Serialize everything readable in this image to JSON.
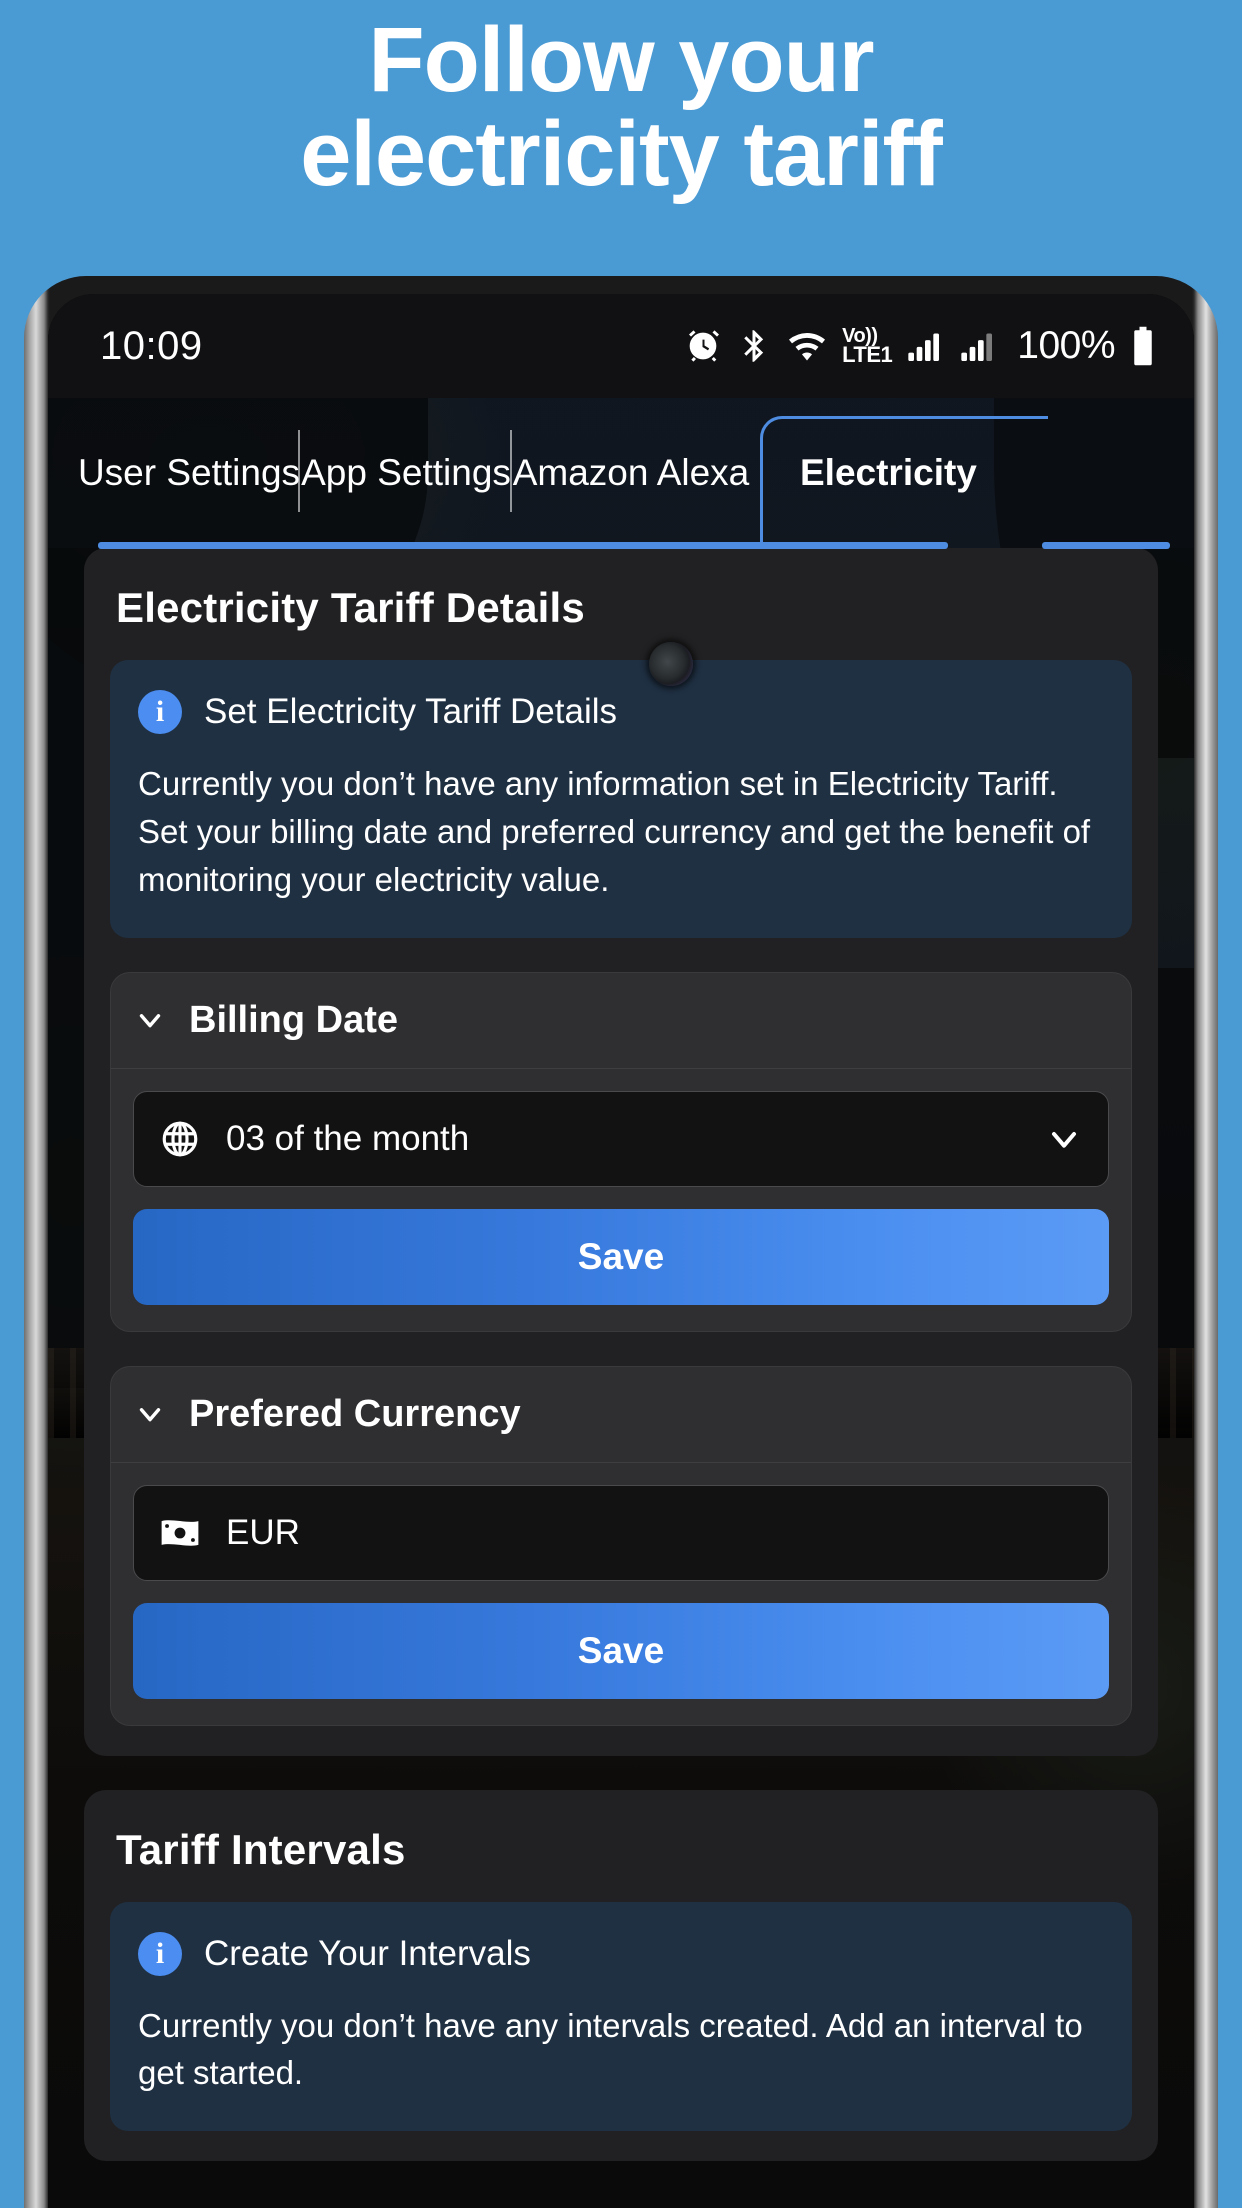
{
  "promo": {
    "line1": "Follow your",
    "line2": "electricity tariff",
    "bg_color": "#4a9ad4",
    "text_color": "#ffffff"
  },
  "status_bar": {
    "time": "10:09",
    "battery_percent": "100%",
    "icons": [
      "alarm-icon",
      "bluetooth-icon",
      "wifi-icon",
      "volte-icon",
      "signal-1-icon",
      "signal-2-icon",
      "battery-icon"
    ],
    "volte_top": "Vo))",
    "volte_bottom": "LTE1"
  },
  "tabs": [
    {
      "label": "User Settings",
      "active": false
    },
    {
      "label": "App Settings",
      "active": false
    },
    {
      "label": "Amazon Alexa",
      "active": false
    },
    {
      "label": "Electricity",
      "active": true
    }
  ],
  "accent_color": "#4d8ce0",
  "tariff_card": {
    "title": "Electricity Tariff Details",
    "info": {
      "icon": "info-icon",
      "title": "Set Electricity Tariff Details",
      "body": "Currently you don’t have any information set in Electricity Tariff. Set your billing date and preferred currency and get the benefit of monitoring your electricity value."
    },
    "sections": [
      {
        "title": "Billing Date",
        "chevron": "chevron-down-icon",
        "field": {
          "icon": "globe-icon",
          "value": "03 of the month",
          "has_chevron": true,
          "chevron": "chevron-down-icon"
        },
        "save_label": "Save"
      },
      {
        "title": "Prefered Currency",
        "chevron": "chevron-down-icon",
        "field": {
          "icon": "banknote-icon",
          "value": "EUR",
          "has_chevron": false,
          "chevron": ""
        },
        "save_label": "Save"
      }
    ]
  },
  "intervals_card": {
    "title": "Tariff Intervals",
    "info": {
      "icon": "info-icon",
      "title": "Create Your Intervals",
      "body": "Currently you don’t have any intervals created. Add an interval to get started."
    }
  }
}
